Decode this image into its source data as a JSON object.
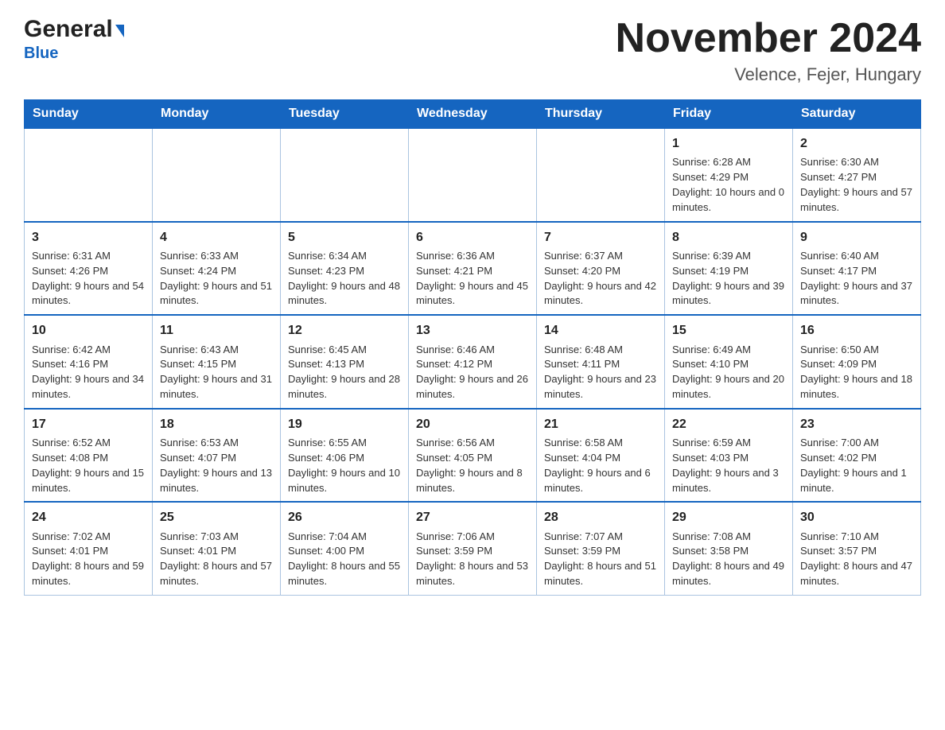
{
  "header": {
    "logo": {
      "general": "General",
      "blue": "Blue"
    },
    "title": "November 2024",
    "subtitle": "Velence, Fejer, Hungary"
  },
  "calendar": {
    "days_of_week": [
      "Sunday",
      "Monday",
      "Tuesday",
      "Wednesday",
      "Thursday",
      "Friday",
      "Saturday"
    ],
    "weeks": [
      {
        "days": [
          {
            "num": "",
            "info": ""
          },
          {
            "num": "",
            "info": ""
          },
          {
            "num": "",
            "info": ""
          },
          {
            "num": "",
            "info": ""
          },
          {
            "num": "",
            "info": ""
          },
          {
            "num": "1",
            "info": "Sunrise: 6:28 AM\nSunset: 4:29 PM\nDaylight: 10 hours and 0 minutes."
          },
          {
            "num": "2",
            "info": "Sunrise: 6:30 AM\nSunset: 4:27 PM\nDaylight: 9 hours and 57 minutes."
          }
        ]
      },
      {
        "days": [
          {
            "num": "3",
            "info": "Sunrise: 6:31 AM\nSunset: 4:26 PM\nDaylight: 9 hours and 54 minutes."
          },
          {
            "num": "4",
            "info": "Sunrise: 6:33 AM\nSunset: 4:24 PM\nDaylight: 9 hours and 51 minutes."
          },
          {
            "num": "5",
            "info": "Sunrise: 6:34 AM\nSunset: 4:23 PM\nDaylight: 9 hours and 48 minutes."
          },
          {
            "num": "6",
            "info": "Sunrise: 6:36 AM\nSunset: 4:21 PM\nDaylight: 9 hours and 45 minutes."
          },
          {
            "num": "7",
            "info": "Sunrise: 6:37 AM\nSunset: 4:20 PM\nDaylight: 9 hours and 42 minutes."
          },
          {
            "num": "8",
            "info": "Sunrise: 6:39 AM\nSunset: 4:19 PM\nDaylight: 9 hours and 39 minutes."
          },
          {
            "num": "9",
            "info": "Sunrise: 6:40 AM\nSunset: 4:17 PM\nDaylight: 9 hours and 37 minutes."
          }
        ]
      },
      {
        "days": [
          {
            "num": "10",
            "info": "Sunrise: 6:42 AM\nSunset: 4:16 PM\nDaylight: 9 hours and 34 minutes."
          },
          {
            "num": "11",
            "info": "Sunrise: 6:43 AM\nSunset: 4:15 PM\nDaylight: 9 hours and 31 minutes."
          },
          {
            "num": "12",
            "info": "Sunrise: 6:45 AM\nSunset: 4:13 PM\nDaylight: 9 hours and 28 minutes."
          },
          {
            "num": "13",
            "info": "Sunrise: 6:46 AM\nSunset: 4:12 PM\nDaylight: 9 hours and 26 minutes."
          },
          {
            "num": "14",
            "info": "Sunrise: 6:48 AM\nSunset: 4:11 PM\nDaylight: 9 hours and 23 minutes."
          },
          {
            "num": "15",
            "info": "Sunrise: 6:49 AM\nSunset: 4:10 PM\nDaylight: 9 hours and 20 minutes."
          },
          {
            "num": "16",
            "info": "Sunrise: 6:50 AM\nSunset: 4:09 PM\nDaylight: 9 hours and 18 minutes."
          }
        ]
      },
      {
        "days": [
          {
            "num": "17",
            "info": "Sunrise: 6:52 AM\nSunset: 4:08 PM\nDaylight: 9 hours and 15 minutes."
          },
          {
            "num": "18",
            "info": "Sunrise: 6:53 AM\nSunset: 4:07 PM\nDaylight: 9 hours and 13 minutes."
          },
          {
            "num": "19",
            "info": "Sunrise: 6:55 AM\nSunset: 4:06 PM\nDaylight: 9 hours and 10 minutes."
          },
          {
            "num": "20",
            "info": "Sunrise: 6:56 AM\nSunset: 4:05 PM\nDaylight: 9 hours and 8 minutes."
          },
          {
            "num": "21",
            "info": "Sunrise: 6:58 AM\nSunset: 4:04 PM\nDaylight: 9 hours and 6 minutes."
          },
          {
            "num": "22",
            "info": "Sunrise: 6:59 AM\nSunset: 4:03 PM\nDaylight: 9 hours and 3 minutes."
          },
          {
            "num": "23",
            "info": "Sunrise: 7:00 AM\nSunset: 4:02 PM\nDaylight: 9 hours and 1 minute."
          }
        ]
      },
      {
        "days": [
          {
            "num": "24",
            "info": "Sunrise: 7:02 AM\nSunset: 4:01 PM\nDaylight: 8 hours and 59 minutes."
          },
          {
            "num": "25",
            "info": "Sunrise: 7:03 AM\nSunset: 4:01 PM\nDaylight: 8 hours and 57 minutes."
          },
          {
            "num": "26",
            "info": "Sunrise: 7:04 AM\nSunset: 4:00 PM\nDaylight: 8 hours and 55 minutes."
          },
          {
            "num": "27",
            "info": "Sunrise: 7:06 AM\nSunset: 3:59 PM\nDaylight: 8 hours and 53 minutes."
          },
          {
            "num": "28",
            "info": "Sunrise: 7:07 AM\nSunset: 3:59 PM\nDaylight: 8 hours and 51 minutes."
          },
          {
            "num": "29",
            "info": "Sunrise: 7:08 AM\nSunset: 3:58 PM\nDaylight: 8 hours and 49 minutes."
          },
          {
            "num": "30",
            "info": "Sunrise: 7:10 AM\nSunset: 3:57 PM\nDaylight: 8 hours and 47 minutes."
          }
        ]
      }
    ]
  }
}
